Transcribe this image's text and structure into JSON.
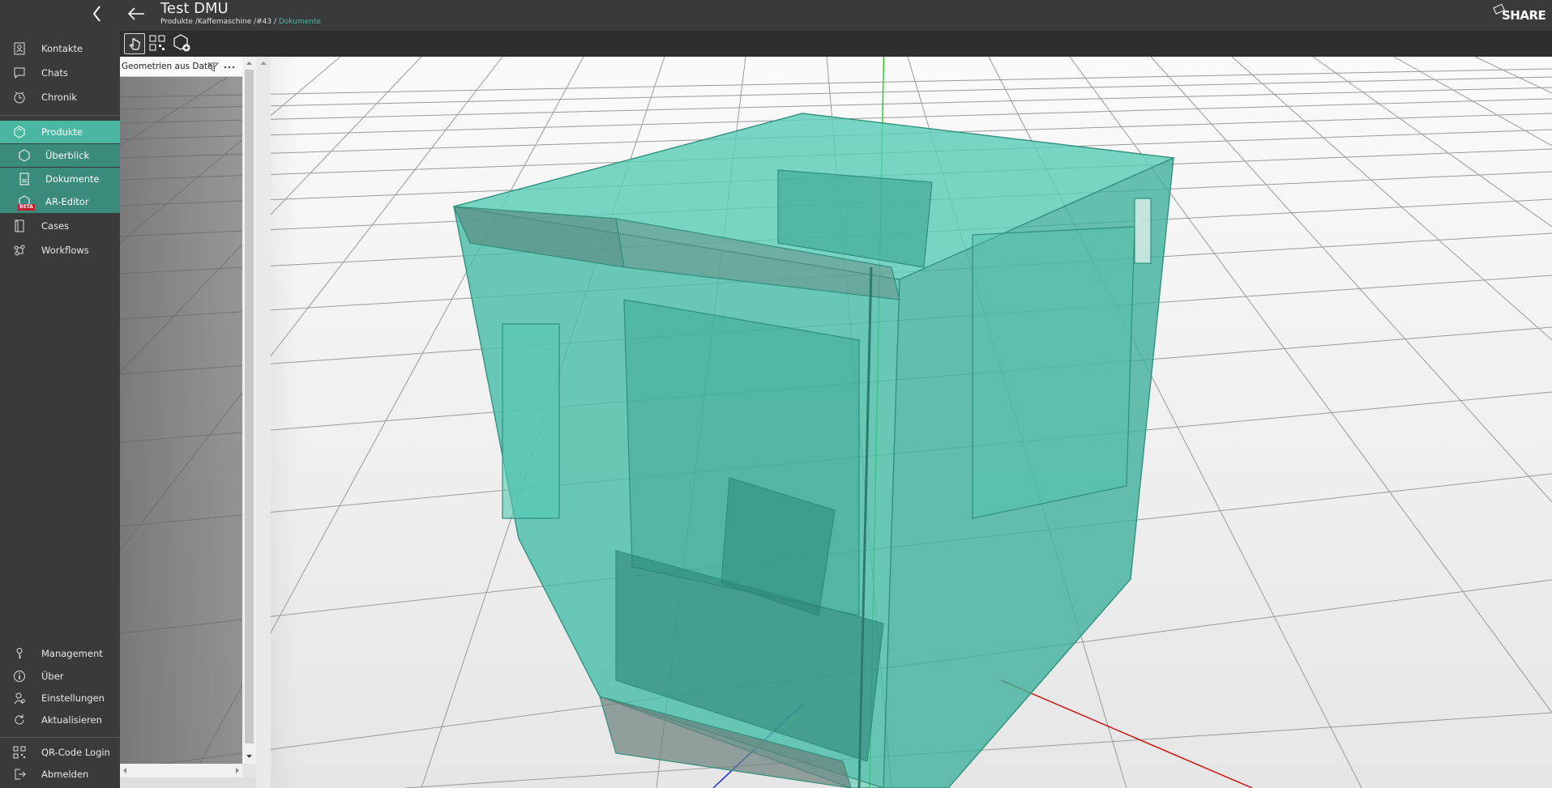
{
  "header": {
    "title": "Test DMU",
    "breadcrumb_path": "Produkte /Kaffemaschine /#43 / ",
    "breadcrumb_current": "Dokumente",
    "logo_text": "SHARE"
  },
  "sidebar": {
    "items": [
      {
        "label": "Kontakte",
        "icon": "contacts-icon"
      },
      {
        "label": "Chats",
        "icon": "chat-icon"
      },
      {
        "label": "Chronik",
        "icon": "clock-icon"
      },
      {
        "label": "Produkte",
        "icon": "product-icon"
      },
      {
        "label": "Überblick",
        "icon": "overview-icon"
      },
      {
        "label": "Dokumente",
        "icon": "document-icon"
      },
      {
        "label": "AR-Editor",
        "icon": "ar-editor-icon",
        "badge": "BETA"
      },
      {
        "label": "Cases",
        "icon": "case-icon"
      },
      {
        "label": "Workflows",
        "icon": "workflow-icon"
      },
      {
        "label": "Management",
        "icon": "key-icon"
      },
      {
        "label": "Über",
        "icon": "info-icon"
      },
      {
        "label": "Einstellungen",
        "icon": "settings-user-icon"
      },
      {
        "label": "Aktualisieren",
        "icon": "refresh-icon"
      },
      {
        "label": "QR-Code Login",
        "icon": "qr-code-icon"
      },
      {
        "label": "Abmelden",
        "icon": "logout-icon"
      }
    ]
  },
  "tree": {
    "header_label": "Geometrien aus Datei"
  },
  "colors": {
    "accent": "#4ab7a1",
    "accent_dark": "#3b8b7c",
    "sidebar_bg": "#3a3a3a",
    "model": "#49c4ad",
    "beta_badge": "#c0202c"
  }
}
